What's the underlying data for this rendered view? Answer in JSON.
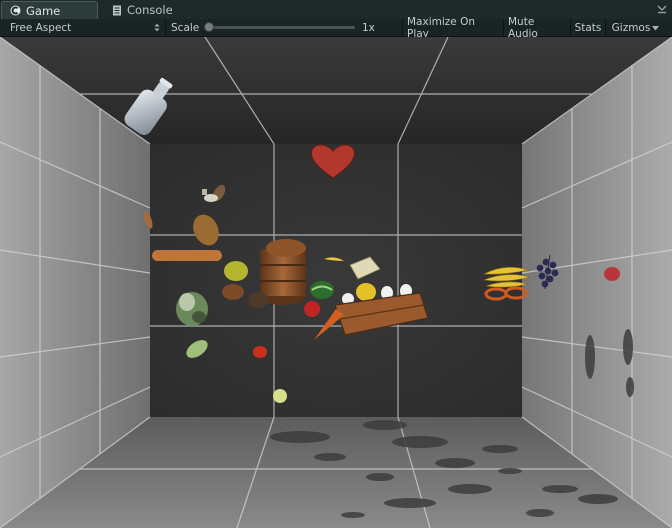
{
  "tabs": [
    {
      "label": "Game",
      "icon": "game-controller-icon",
      "active": true
    },
    {
      "label": "Console",
      "icon": "console-log-icon",
      "active": false
    }
  ],
  "toolbar": {
    "aspect": "Free Aspect",
    "scale_label": "Scale",
    "scale_value": "1x",
    "scale_level": 0.0,
    "maximize_label": "Maximize On Play",
    "mute_label": "Mute Audio",
    "stats_label": "Stats",
    "gizmos_label": "Gizmos"
  },
  "colors": {
    "tab_bar": "#1e2a2a",
    "toolbar": "#1b2424",
    "room_back_wall": "#333333",
    "room_side_wall": "#8a8a8a",
    "room_floor": "#6a6a6a",
    "room_ceiling": "#2e2e2e",
    "grid_line": "#cfd3d8"
  },
  "scene_objects": [
    "glass-bottle",
    "heart",
    "mushroom",
    "sausage",
    "potato",
    "croissant-bread",
    "wooden-barrel",
    "banana",
    "lemon",
    "cabbage",
    "avocado",
    "kiwi",
    "watermelon",
    "cheese-block",
    "lemon-yellow",
    "milk-bottles",
    "wooden-crate",
    "strawberry",
    "carrot",
    "cucumber",
    "tomato",
    "bananas-bunch",
    "pretzel",
    "grapes",
    "apple",
    "pear",
    "lettuce"
  ]
}
